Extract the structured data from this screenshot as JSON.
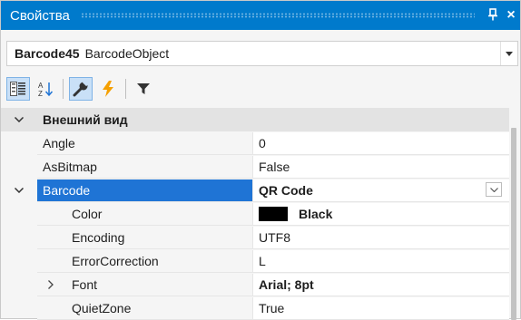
{
  "window": {
    "title": "Свойства",
    "pin_glyph": "ᵖ",
    "close_glyph": "×"
  },
  "object_selector": {
    "name": "Barcode45",
    "type": "BarcodeObject"
  },
  "toolbar": {
    "buttons": [
      {
        "id": "categorized",
        "icon": "categorized-icon",
        "active": true
      },
      {
        "id": "alphabetical",
        "icon": "sort-az-icon",
        "active": false
      },
      {
        "id": "properties",
        "icon": "wrench-icon",
        "active": true
      },
      {
        "id": "events",
        "icon": "lightning-icon",
        "active": false
      },
      {
        "id": "filter",
        "icon": "filter-icon",
        "active": false
      }
    ]
  },
  "grid": {
    "category": {
      "label": "Внешний вид",
      "expanded": true
    },
    "rows": [
      {
        "name": "Angle",
        "value": "0"
      },
      {
        "name": "AsBitmap",
        "value": "False"
      },
      {
        "name": "Barcode",
        "value": "QR Code"
      },
      {
        "name": "Color",
        "value": "Black"
      },
      {
        "name": "Encoding",
        "value": "UTF8"
      },
      {
        "name": "ErrorCorrection",
        "value": "L"
      },
      {
        "name": "Font",
        "value": "Arial; 8pt"
      },
      {
        "name": "QuietZone",
        "value": "True"
      }
    ]
  },
  "colors": {
    "titlebar": "#007acc",
    "selection": "#1f74d5",
    "category_bg": "#e3e3e3",
    "color_swatch": "#000000"
  }
}
